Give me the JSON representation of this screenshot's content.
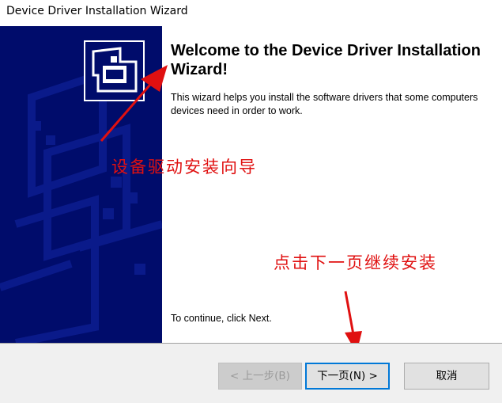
{
  "window": {
    "title": "Device Driver Installation Wizard"
  },
  "content": {
    "heading": "Welcome to the Device Driver Installation Wizard!",
    "description": "This wizard helps you install the software drivers that some computers devices need in order to work.",
    "continue_text": "To continue, click Next."
  },
  "annotations": {
    "wizard_label": "设备驱动安装向导",
    "next_hint": "点击下一页继续安装"
  },
  "buttons": {
    "back_label": "< 上一步(B)",
    "next_label": "下一页(N) >",
    "cancel_label": "取消",
    "back_enabled": false
  },
  "colors": {
    "banner_bg": "#000c6b",
    "annotation_red": "#e01010",
    "focus_blue": "#0078d7"
  },
  "icons": {
    "wizard_logo": "hardware-box-icon"
  }
}
